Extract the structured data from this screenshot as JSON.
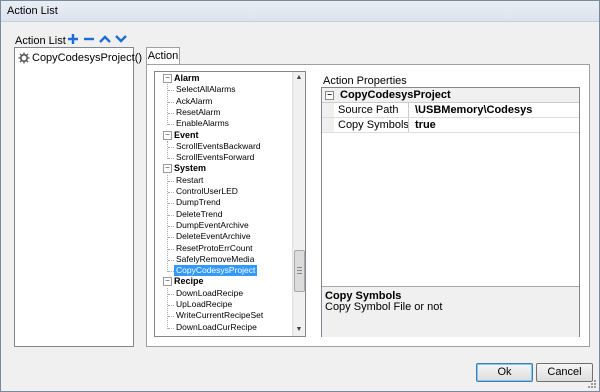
{
  "window": {
    "title": "Action List"
  },
  "left_panel": {
    "label": "Action List",
    "toolbar": {
      "add": "add-icon",
      "remove": "remove-icon",
      "up": "move-up-icon",
      "down": "move-down-icon"
    },
    "items": [
      "CopyCodesysProject()"
    ]
  },
  "tabs": [
    "Action"
  ],
  "tree": {
    "categories": [
      {
        "name": "Alarm",
        "items": [
          "SelectAllAlarms",
          "AckAlarm",
          "ResetAlarm",
          "EnableAlarms"
        ]
      },
      {
        "name": "Event",
        "items": [
          "ScrollEventsBackward",
          "ScrollEventsForward"
        ]
      },
      {
        "name": "System",
        "items": [
          "Restart",
          "ControlUserLED",
          "DumpTrend",
          "DeleteTrend",
          "DumpEventArchive",
          "DeleteEventArchive",
          "ResetProtoErrCount",
          "SafelyRemoveMedia",
          "CopyCodesysProject"
        ]
      },
      {
        "name": "Recipe",
        "items": [
          "DownLoadRecipe",
          "UpLoadRecipe",
          "WriteCurrentRecipeSet",
          "DownLoadCurRecipe"
        ]
      }
    ],
    "selected": "CopyCodesysProject"
  },
  "properties": {
    "label": "Action Properties",
    "group": "CopyCodesysProject",
    "rows": [
      {
        "key": "Source Path",
        "value": "\\USBMemory\\Codesys"
      },
      {
        "key": "Copy Symbols",
        "value": "true"
      }
    ],
    "description": {
      "title": "Copy Symbols",
      "text": "Copy Symbol File or not"
    }
  },
  "buttons": {
    "ok": "Ok",
    "cancel": "Cancel"
  },
  "colors": {
    "selection": "#3399ff",
    "toolbar_icons": "#1a6fd6"
  }
}
